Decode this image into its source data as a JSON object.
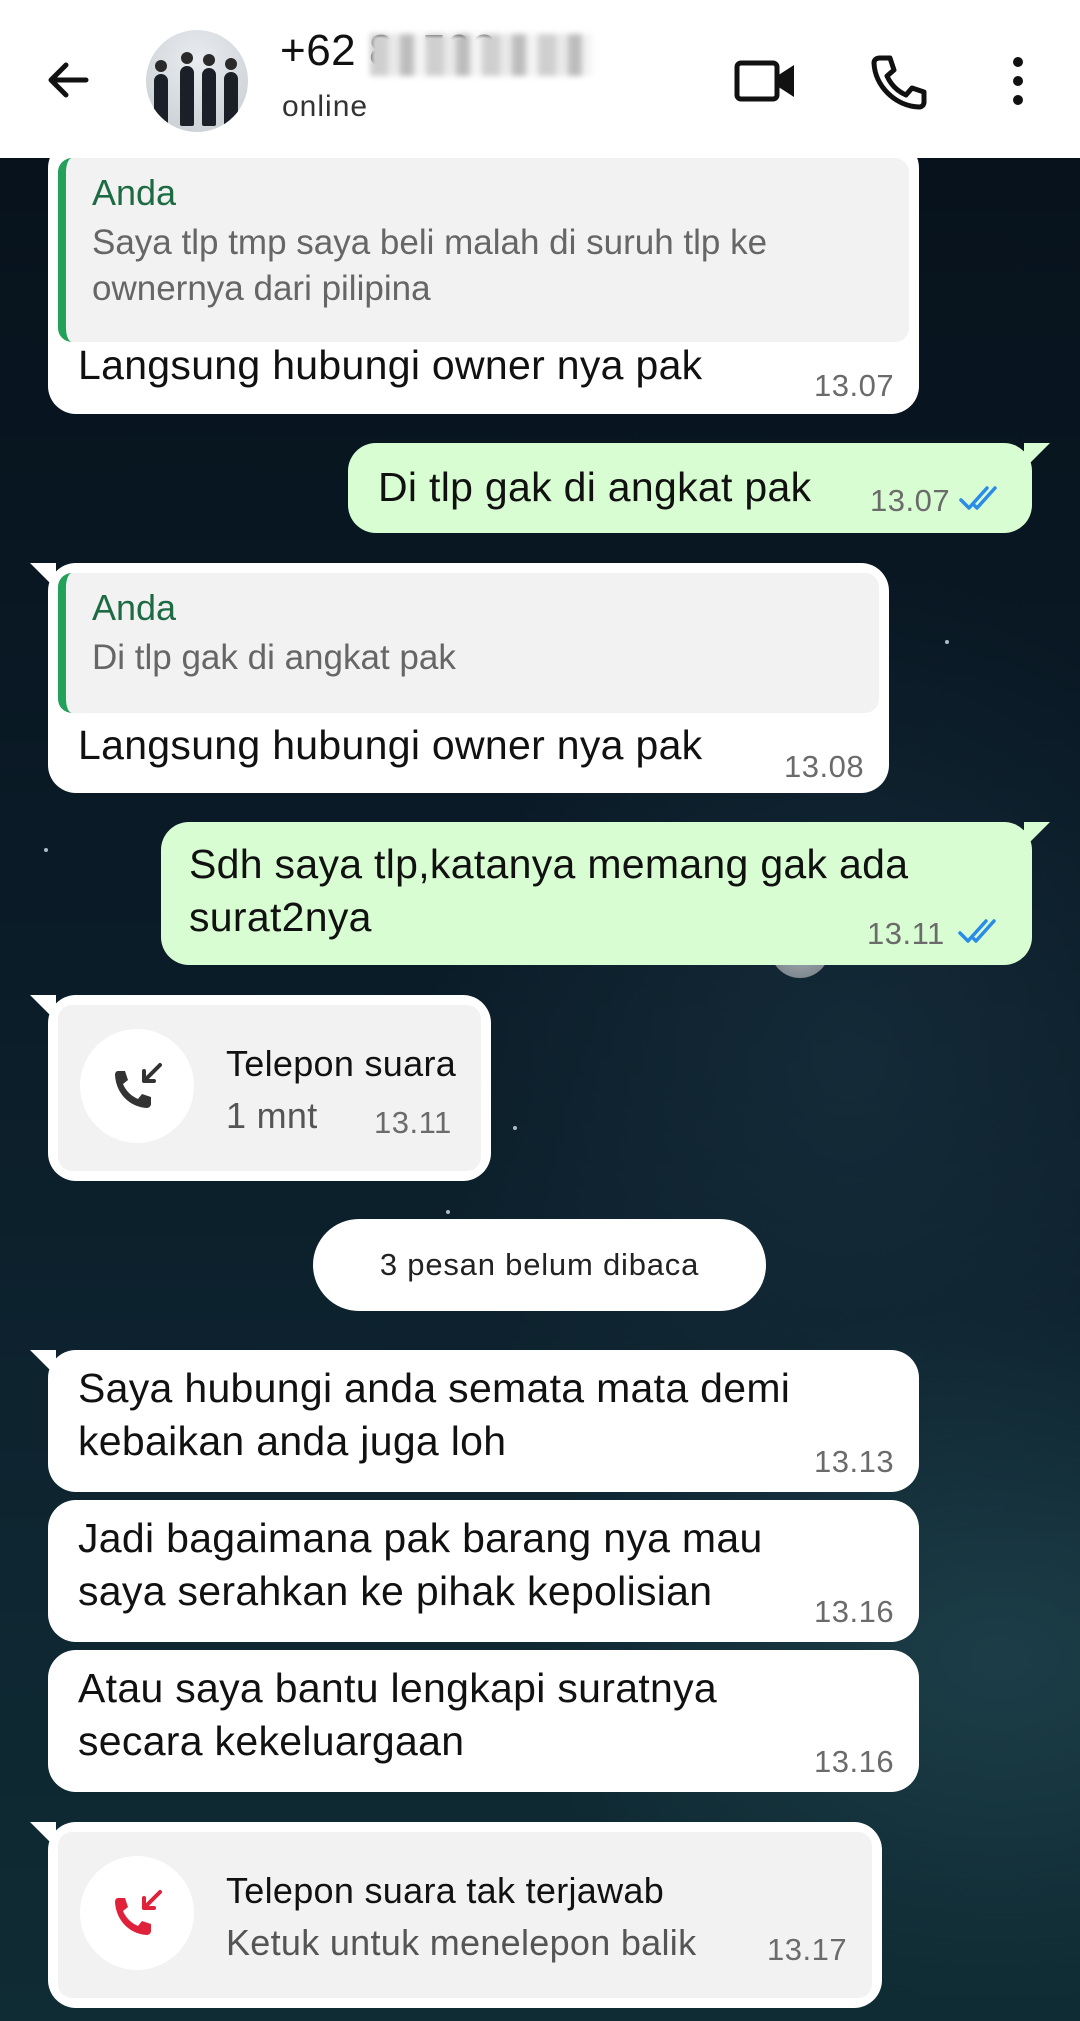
{
  "header": {
    "contact_name": "+62 8            -502",
    "status": "online"
  },
  "colors": {
    "incoming_bubble": "#ffffff",
    "outgoing_bubble": "#d9fdd3",
    "quote_bar": "#23a05a",
    "read_ticks": "#2a8be8",
    "missed_call": "#e0213a"
  },
  "messages": [
    {
      "direction": "in",
      "quote_author": "Anda",
      "quote_text": "Saya tlp tmp saya beli malah di suruh tlp ke ownernya dari pilipina",
      "text": "Langsung hubungi owner nya pak",
      "time": "13.07"
    },
    {
      "direction": "out",
      "text": "Di tlp gak di angkat pak",
      "time": "13.07",
      "status": "read"
    },
    {
      "direction": "in",
      "quote_author": "Anda",
      "quote_text": "Di tlp gak di angkat pak",
      "text": "Langsung hubungi owner nya pak",
      "time": "13.08"
    },
    {
      "direction": "out",
      "text": "Sdh saya tlp,katanya memang gak ada surat2nya",
      "time": "13.11",
      "status": "read"
    },
    {
      "direction": "in",
      "type": "call",
      "icon": "incoming-call-icon",
      "title": "Telepon suara",
      "subtitle": "1 mnt",
      "time": "13.11"
    },
    {
      "type": "unread_divider",
      "text": "3 pesan belum dibaca"
    },
    {
      "direction": "in",
      "text": "Saya hubungi anda semata mata demi kebaikan anda juga loh",
      "time": "13.13"
    },
    {
      "direction": "in",
      "text": "Jadi bagaimana pak barang nya mau saya serahkan ke pihak kepolisian",
      "time": "13.16"
    },
    {
      "direction": "in",
      "text": "Atau saya bantu lengkapi suratnya secara kekeluargaan",
      "time": "13.16"
    },
    {
      "direction": "in",
      "type": "call",
      "icon": "missed-call-icon",
      "title": "Telepon suara tak terjawab",
      "subtitle": "Ketuk untuk menelepon balik",
      "time": "13.17"
    }
  ]
}
